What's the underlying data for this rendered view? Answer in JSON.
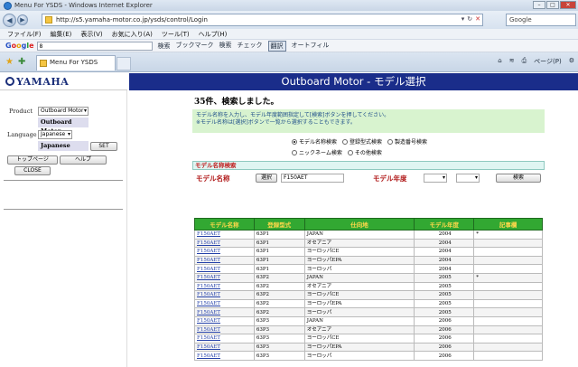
{
  "window": {
    "title": "Menu For YSDS - Windows Internet Explorer"
  },
  "address": {
    "url": "http://s5.yamaha-motor.co.jp/ysds/control/Login",
    "search_placeholder": "Google"
  },
  "menu": [
    "ファイル(F)",
    "編集(E)",
    "表示(V)",
    "お気に入り(A)",
    "ツール(T)",
    "ヘルプ(H)"
  ],
  "google_toolbar": {
    "logo": [
      "G",
      "o",
      "o",
      "g",
      "l",
      "e"
    ],
    "search_value": "8",
    "search_label": "検索",
    "items": [
      "ブックマーク",
      "検索",
      "チェック",
      "翻訳",
      "オートフィル"
    ],
    "selected_item_index": 3
  },
  "tab": {
    "title": "Menu For YSDS"
  },
  "tab_tools": [
    "ページ(P)"
  ],
  "sidebar": {
    "logo_text": "YAMAHA",
    "product_label": "Product",
    "product_select": "Outboard Motor",
    "product_value": "Outboard Motor",
    "language_label": "Language",
    "language_select": "Japanese",
    "language_value": "Japanese",
    "set_button": "SET",
    "top_button": "トップページ",
    "help_button": "ヘルプ",
    "close_button": "CLOSE"
  },
  "main": {
    "header": "Outboard Motor - モデル選択",
    "result_count": "35件、検索しました。",
    "notice_line1": "モデル名称を入力し、モデル年度範囲指定して[検索]ボタンを押してください。",
    "notice_line2": "※モデル名称は[選択]ボタンで一覧から選択することもできます。",
    "radio_options": [
      {
        "label": "モデル名称検索",
        "checked": true
      },
      {
        "label": "登録型式検索",
        "checked": false
      },
      {
        "label": "製造番号検索",
        "checked": false
      },
      {
        "label": "ニックネーム検索",
        "checked": false
      },
      {
        "label": "その他検索",
        "checked": false
      }
    ],
    "search_title": "モデル名称検索",
    "model_name_label": "モデル名称",
    "select_button": "選択",
    "model_name_value": "F150AET",
    "model_year_label": "モデル年度",
    "search_button": "検索"
  },
  "table": {
    "headers": [
      "モデル名称",
      "登録型式",
      "仕向地",
      "モデル年度",
      "記事欄"
    ],
    "rows": [
      [
        "F150AET",
        "63P1",
        "JAPAN",
        "2004",
        "*"
      ],
      [
        "F150AET",
        "63P1",
        "オセアニア",
        "2004",
        ""
      ],
      [
        "F150AET",
        "63P1",
        "ヨーロッパCE",
        "2004",
        ""
      ],
      [
        "F150AET",
        "63P1",
        "ヨーロッパEPA",
        "2004",
        ""
      ],
      [
        "F150AET",
        "63P1",
        "ヨーロッパ",
        "2004",
        ""
      ],
      [
        "F150AET",
        "63P2",
        "JAPAN",
        "2005",
        "*"
      ],
      [
        "F150AET",
        "63P2",
        "オセアニア",
        "2005",
        ""
      ],
      [
        "F150AET",
        "63P2",
        "ヨーロッパCE",
        "2005",
        ""
      ],
      [
        "F150AET",
        "63P2",
        "ヨーロッパEPA",
        "2005",
        ""
      ],
      [
        "F150AET",
        "63P2",
        "ヨーロッパ",
        "2005",
        ""
      ],
      [
        "F150AET",
        "63P3",
        "JAPAN",
        "2006",
        ""
      ],
      [
        "F150AET",
        "63P3",
        "オセアニア",
        "2006",
        ""
      ],
      [
        "F150AET",
        "63P3",
        "ヨーロッパCE",
        "2006",
        ""
      ],
      [
        "F150AET",
        "63P3",
        "ヨーロッパEPA",
        "2006",
        ""
      ],
      [
        "F150AET",
        "63P3",
        "ヨーロッパ",
        "2006",
        ""
      ]
    ]
  }
}
